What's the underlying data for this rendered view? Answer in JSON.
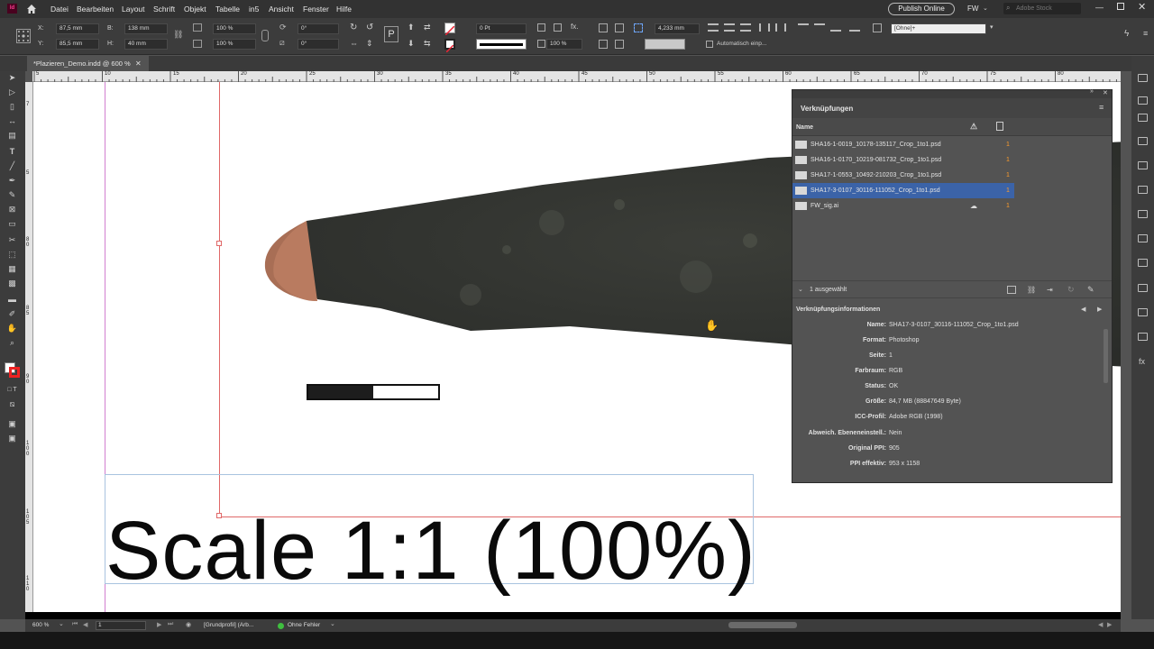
{
  "menubar": {
    "logo": "Id",
    "items": [
      "Datei",
      "Bearbeiten",
      "Layout",
      "Schrift",
      "Objekt",
      "Tabelle",
      "in5",
      "Ansicht",
      "Fenster",
      "Hilfe"
    ],
    "publish_online": "Publish Online",
    "workspace": "FW",
    "search_placeholder": "Adobe Stock"
  },
  "control": {
    "x_label": "X:",
    "x_value": "87,5 mm",
    "y_label": "Y:",
    "y_value": "85,5 mm",
    "w_label": "B:",
    "w_value": "138 mm",
    "h_label": "H:",
    "h_value": "40 mm",
    "scale_x": "100 %",
    "scale_y": "100 %",
    "rotate": "0°",
    "shear": "0°",
    "stroke_weight": "0 Pt",
    "opacity": "100 %",
    "ref_value": "4,233 mm",
    "auto_fit": "Automatisch einp...",
    "style_value": "[Ohne]+"
  },
  "document": {
    "tab_title": "*Plazieren_Demo.indd @ 600 %",
    "ruler_h": [
      "5",
      "10",
      "15",
      "20",
      "25",
      "30",
      "35",
      "40",
      "45",
      "50",
      "55",
      "60",
      "65",
      "70",
      "75",
      "80"
    ],
    "ruler_v": [
      "7",
      "5",
      "8",
      "0",
      "8",
      "5",
      "9",
      "0",
      "9",
      "5",
      "1 0 0",
      "1 0 5",
      "1 1 0"
    ],
    "scale_text": "Scale 1:1 (100%)"
  },
  "links_panel": {
    "tab_title": "Verknüpfungen",
    "column_name": "Name",
    "links": [
      {
        "name": "SHA16-1-0019_10178-135117_Crop_1to1.psd",
        "page": "1",
        "selected": false
      },
      {
        "name": "SHA16-1-0170_10219-081732_Crop_1to1.psd",
        "page": "1",
        "selected": false
      },
      {
        "name": "SHA17-1-0553_10492-210203_Crop_1to1.psd",
        "page": "1",
        "selected": false
      },
      {
        "name": "SHA17-3-0107_30116-111052_Crop_1to1.psd",
        "page": "1",
        "selected": true
      },
      {
        "name": "FW_sig.ai",
        "page": "1",
        "selected": false
      }
    ],
    "selected_count": "1 ausgewählt",
    "info_title": "Verknüpfungsinformationen",
    "info": [
      {
        "key": "Name:",
        "value": "SHA17-3-0107_30116-111052_Crop_1to1.psd"
      },
      {
        "key": "Format:",
        "value": "Photoshop"
      },
      {
        "key": "Seite:",
        "value": "1"
      },
      {
        "key": "Farbraum:",
        "value": "RGB"
      },
      {
        "key": "Status:",
        "value": "OK"
      },
      {
        "key": "Größe:",
        "value": "84,7 MB (88847649 Byte)"
      },
      {
        "key": "ICC-Profil:",
        "value": "Adobe RGB (1998)"
      },
      {
        "key": "Abweich. Ebeneneinstell.:",
        "value": "Nein"
      },
      {
        "key": "Original PPI:",
        "value": "905"
      },
      {
        "key": "PPI effektiv:",
        "value": "953 x 1158"
      }
    ]
  },
  "status": {
    "zoom": "600 %",
    "page": "1",
    "profile": "[Grundprofil] (Arb...",
    "preflight": "Ohne Fehler"
  },
  "colors": {
    "selection": "#3b63a8",
    "page_warning": "#ff9c2b",
    "preflight_ok": "#3fbf3f"
  }
}
